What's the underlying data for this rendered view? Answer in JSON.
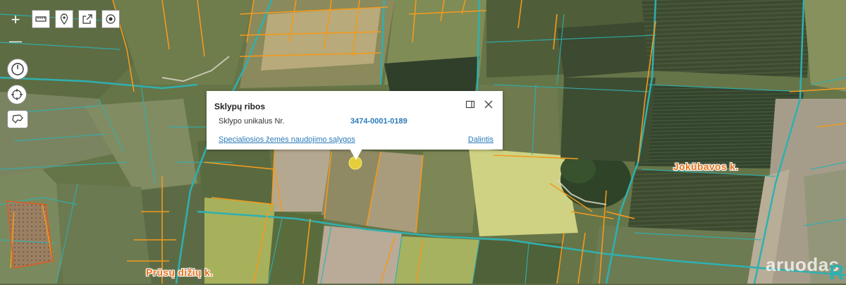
{
  "map": {
    "marker_color": "#e4cf3a",
    "parcel_line_color": "#f29a1e",
    "road_color": "#2fb0b0",
    "labels": [
      {
        "text": "Jokūbavos k."
      },
      {
        "text": "Prūsų dižių k."
      }
    ]
  },
  "controls": {
    "zoom_in": "+",
    "zoom_out": "—"
  },
  "popup": {
    "title": "Sklypų ribos",
    "field_key": "Sklypo unikalus Nr.",
    "field_value": "3474-0001-0189",
    "link_conditions": "Specialiosios žemės naudojimo sąlygos",
    "link_share": "Dalintis"
  },
  "watermark": {
    "text": "aruodas.lt",
    "logo": "R"
  }
}
